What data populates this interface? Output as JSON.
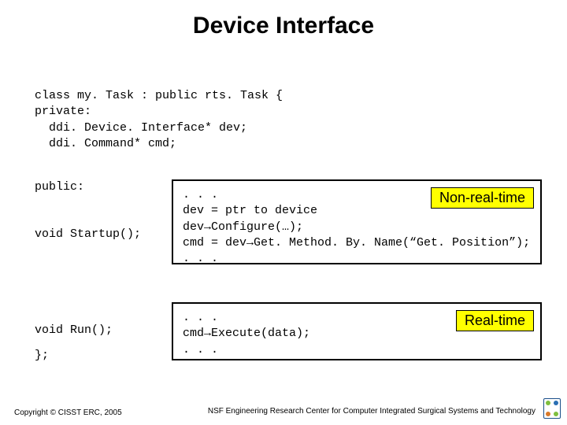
{
  "title": "Device Interface",
  "code_top": "class my. Task : public rts. Task {\nprivate:\n  ddi. Device. Interface* dev;\n  ddi. Command* cmd;",
  "left": {
    "public_line": "public:",
    "startup_line": "void Startup();",
    "run_line": "void Run();",
    "brace_line": "};"
  },
  "box1": {
    "badge": "Non-real-time",
    "code": ". . .\ndev = ptr to device\ndev→Configure(…);\ncmd = dev→Get. Method. By. Name(“Get. Position”);\n. . ."
  },
  "box2": {
    "badge": "Real-time",
    "code": ". . .\ncmd→Execute(data);\n. . ."
  },
  "footer_left": "Copyright © CISST ERC, 2005",
  "footer_right": "NSF Engineering Research Center for Computer Integrated Surgical Systems and Technology"
}
